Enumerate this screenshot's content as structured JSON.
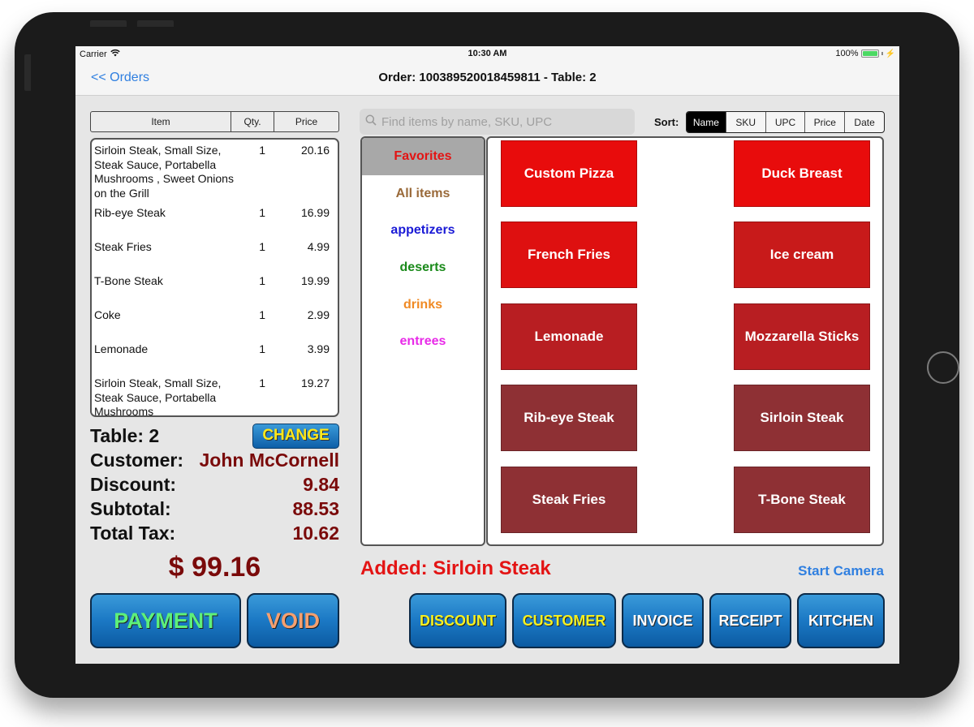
{
  "status_bar": {
    "carrier": "Carrier",
    "time": "10:30 AM",
    "battery_percent": "100%"
  },
  "nav": {
    "back_label": "<< Orders",
    "title": "Order: 100389520018459811 - Table: 2"
  },
  "order_table": {
    "headers": {
      "item": "Item",
      "qty": "Qty.",
      "price": "Price"
    },
    "rows": [
      {
        "name": "Sirloin Steak, Small Size, Steak Sauce, Portabella Mushrooms , Sweet Onions on the Grill",
        "qty": "1",
        "price": "20.16"
      },
      {
        "name": "Rib-eye Steak",
        "qty": "1",
        "price": "16.99"
      },
      {
        "name": "Steak Fries",
        "qty": "1",
        "price": "4.99"
      },
      {
        "name": "T-Bone Steak",
        "qty": "1",
        "price": "19.99"
      },
      {
        "name": "Coke",
        "qty": "1",
        "price": "2.99"
      },
      {
        "name": "Lemonade",
        "qty": "1",
        "price": "3.99"
      },
      {
        "name": "Sirloin Steak, Small Size, Steak Sauce, Portabella Mushrooms",
        "qty": "1",
        "price": "19.27"
      }
    ]
  },
  "summary": {
    "table_label": "Table: 2",
    "change_label": "CHANGE",
    "customer_label": "Customer:",
    "customer_name": "John McCornell",
    "discount_label": "Discount:",
    "discount_value": "9.84",
    "subtotal_label": "Subtotal:",
    "subtotal_value": "88.53",
    "tax_label": "Total Tax:",
    "tax_value": "10.62",
    "total": "$ 99.16"
  },
  "search": {
    "placeholder": "Find items by name, SKU, UPC",
    "value": ""
  },
  "sort": {
    "label": "Sort:",
    "options": [
      "Name",
      "SKU",
      "UPC",
      "Price",
      "Date"
    ],
    "selected": "Name"
  },
  "categories": [
    {
      "label": "Favorites",
      "color": "#e31414",
      "active": true
    },
    {
      "label": "All items",
      "color": "#9a6a3a",
      "active": false
    },
    {
      "label": "appetizers",
      "color": "#1a1ad6",
      "active": false
    },
    {
      "label": "deserts",
      "color": "#1a8a1a",
      "active": false
    },
    {
      "label": "drinks",
      "color": "#f08a24",
      "active": false
    },
    {
      "label": "entrees",
      "color": "#e82ae8",
      "active": false
    }
  ],
  "items": [
    {
      "label": "Custom Pizza",
      "color": "#e80c0c"
    },
    {
      "label": "Duck Breast",
      "color": "#e80c0c"
    },
    {
      "label": "French Fries",
      "color": "#de1010"
    },
    {
      "label": "Ice cream",
      "color": "#c81a1a"
    },
    {
      "label": "Lemonade",
      "color": "#b81e22"
    },
    {
      "label": "Mozzarella Sticks",
      "color": "#b81e22"
    },
    {
      "label": "Rib-eye Steak",
      "color": "#8e3034"
    },
    {
      "label": "Sirloin Steak",
      "color": "#8e3034"
    },
    {
      "label": "Steak Fries",
      "color": "#8e3034"
    },
    {
      "label": "T-Bone Steak",
      "color": "#8e3034"
    }
  ],
  "messages": {
    "added": "Added: Sirloin Steak",
    "start_camera": "Start Camera"
  },
  "actions": {
    "payment": {
      "label": "PAYMENT",
      "color": "#5ef07a"
    },
    "void": {
      "label": "VOID",
      "color": "#f5a070"
    },
    "discount": {
      "label": "DISCOUNT",
      "color": "#f5f020"
    },
    "customer": {
      "label": "CUSTOMER",
      "color": "#f5f020"
    },
    "invoice": {
      "label": "INVOICE",
      "color": "#ffffff"
    },
    "receipt": {
      "label": "RECEIPT",
      "color": "#ffffff"
    },
    "kitchen": {
      "label": "KITCHEN",
      "color": "#ffffff"
    }
  },
  "theme": {
    "accent_blue": "#2f7fe0",
    "money_red": "#7a0a0a"
  }
}
